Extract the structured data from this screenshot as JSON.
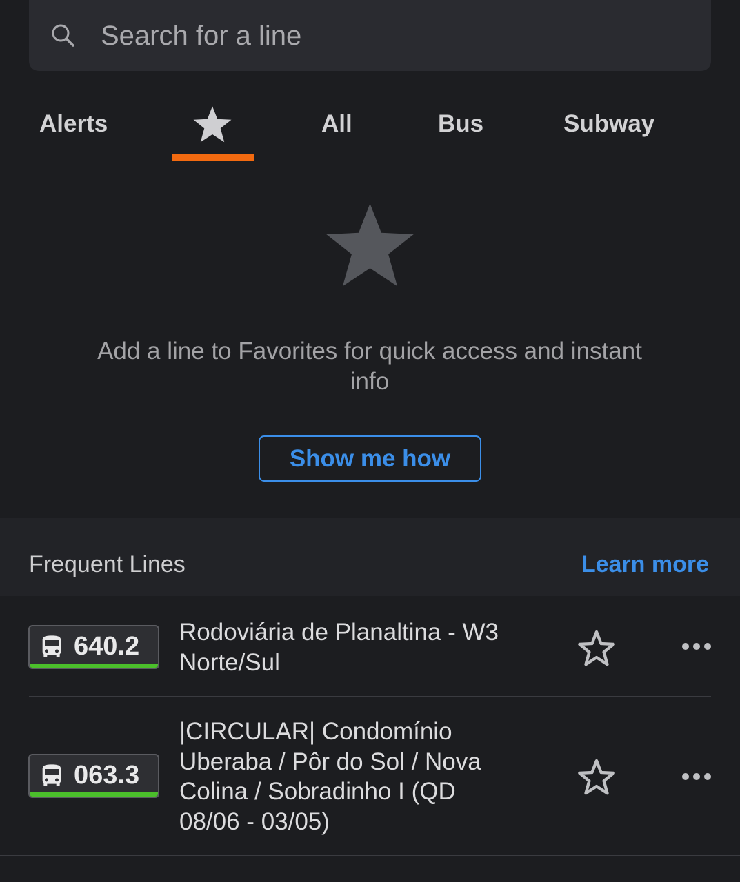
{
  "search": {
    "placeholder": "Search for a line",
    "icon": "search-icon"
  },
  "tabs": [
    {
      "label": "Alerts"
    },
    {
      "label": "",
      "icon": "star-icon",
      "active": true
    },
    {
      "label": "All"
    },
    {
      "label": "Bus"
    },
    {
      "label": "Subway"
    }
  ],
  "empty_state": {
    "icon": "star-icon",
    "message": "Add a line to Favorites for quick access and instant info",
    "button_label": "Show me how"
  },
  "frequent_lines": {
    "title": "Frequent Lines",
    "learn_more_label": "Learn more",
    "items": [
      {
        "number": "640.2",
        "name": "Rodoviária de Planaltina - W3 Norte/Sul",
        "icon": "bus-icon"
      },
      {
        "number": "063.3",
        "name": "|CIRCULAR| Condomínio Uberaba / Pôr do Sol / Nova Colina / Sobradinho I (QD 08/06 - 03/05)",
        "icon": "bus-icon"
      }
    ]
  },
  "colors": {
    "background": "#1c1d20",
    "accent_orange": "#f26a10",
    "link_blue": "#3b8ee8",
    "line_green": "#4bbf2b"
  }
}
